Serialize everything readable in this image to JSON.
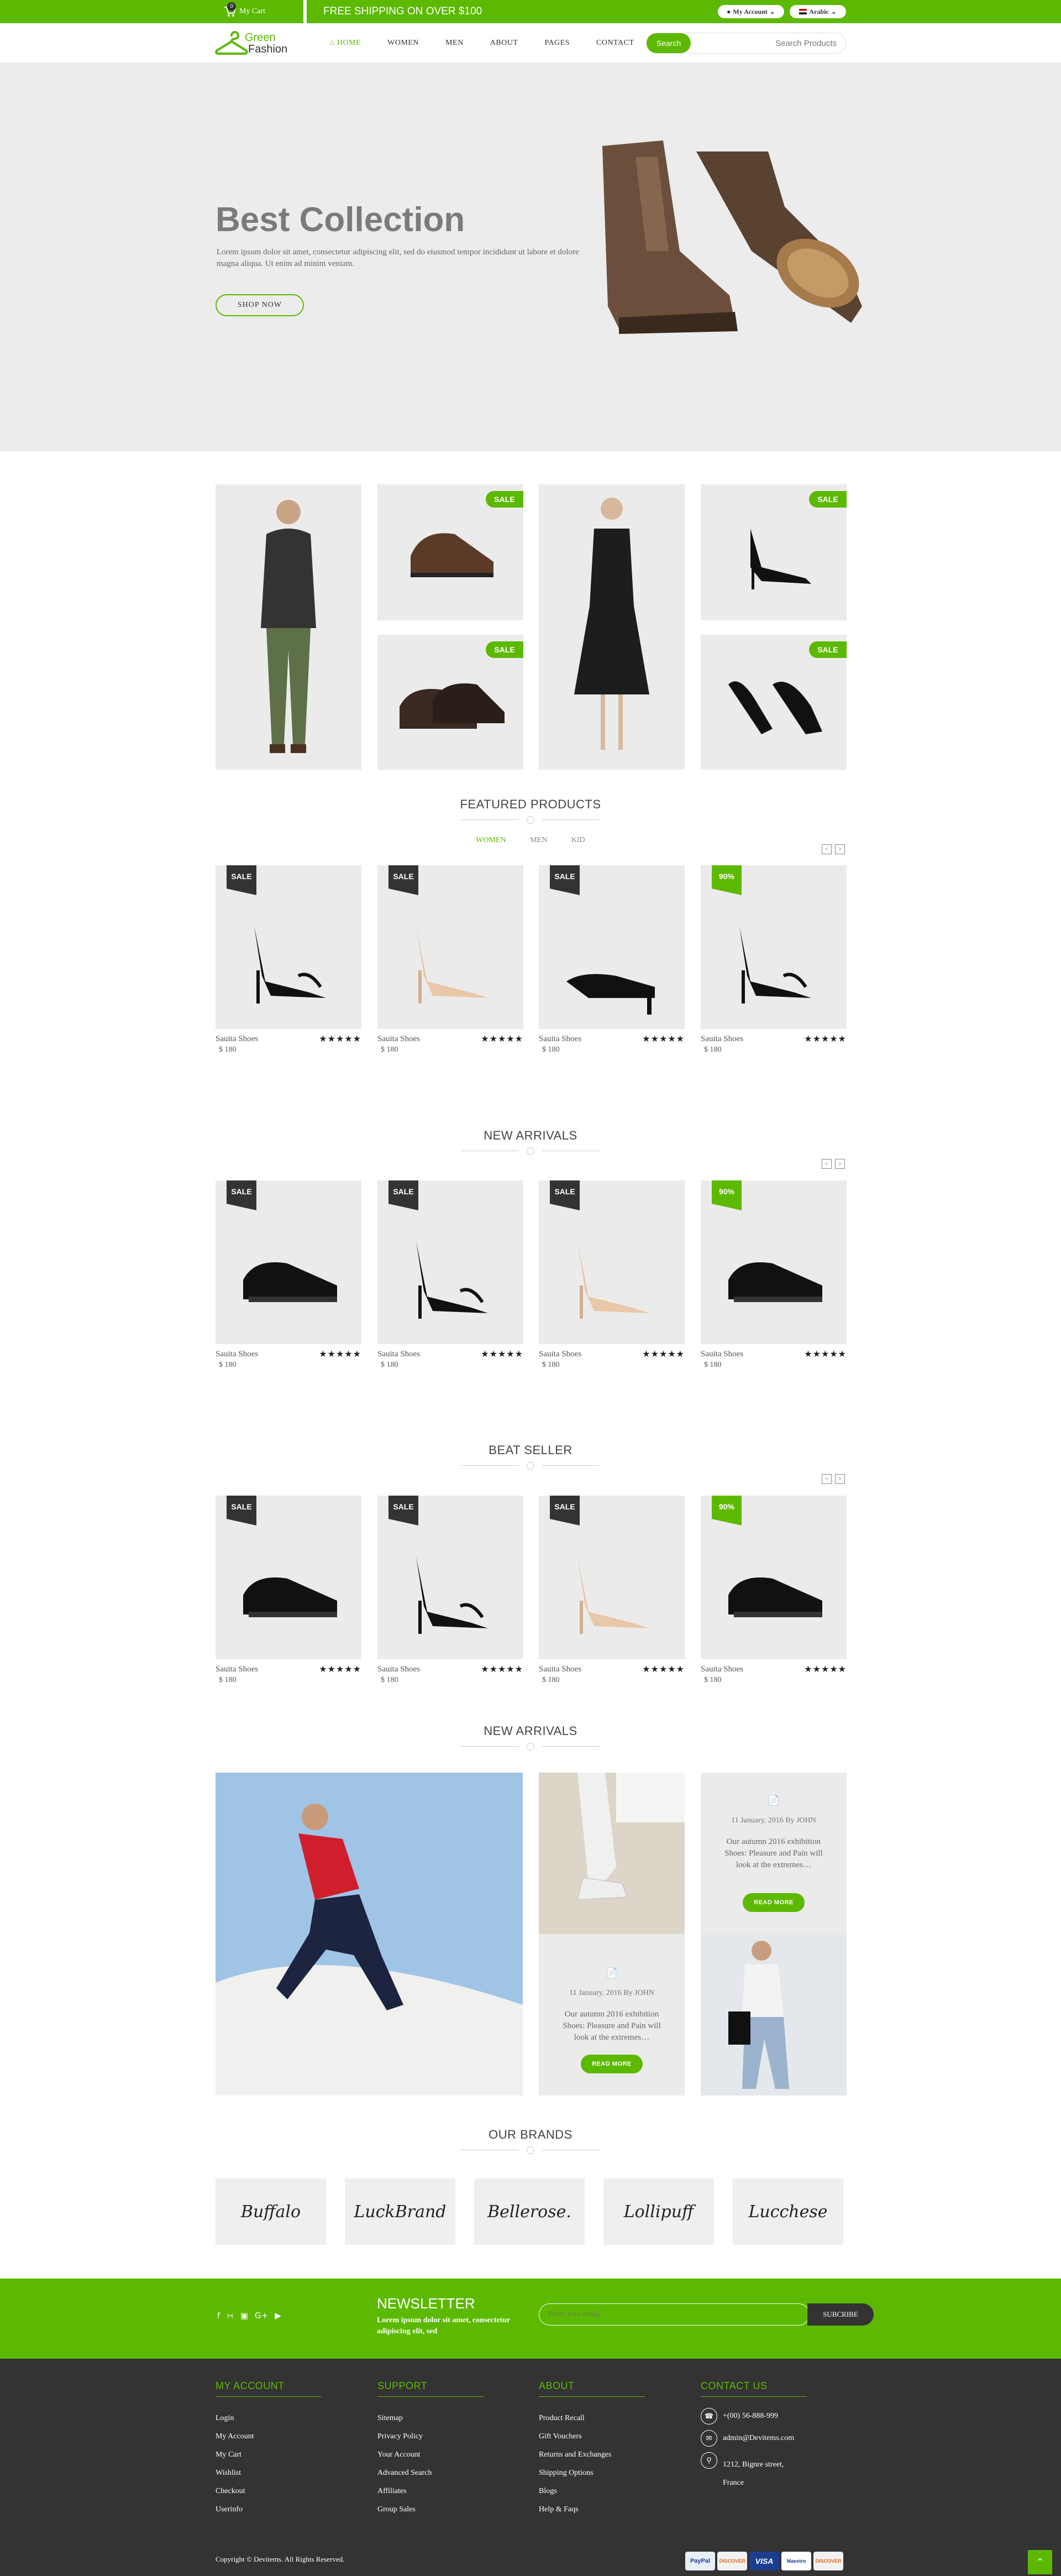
{
  "topbar": {
    "cart_label": "My Cart",
    "cart_count": "0",
    "shipping": "FREE SHIPPING ON OVER $100",
    "account": "My Account",
    "language": "Arabic"
  },
  "brand": {
    "line1": "Green",
    "line2": "Fashion"
  },
  "nav": {
    "home": "HOME",
    "women": "WOMEN",
    "men": "MEN",
    "about": "ABOUT",
    "pages": "PAGES",
    "contact": "CONTACT"
  },
  "search": {
    "button": "Search",
    "placeholder": "Search Products"
  },
  "hero": {
    "title": "Best Collection",
    "text": "Lorem ipsum dolor sit amet, consectetur adipiscing elit, sed do eiusmod tempor incididunt ut labore et dolore magna aliqua. Ut enim ad minim veniam.",
    "button": "SHOP NOW"
  },
  "promo": {
    "sale": "SALE"
  },
  "featured": {
    "title": "FEATURED PRODUCTS",
    "tabs": [
      "WOMEN",
      "MEN",
      "KID"
    ]
  },
  "new_arrivals": {
    "title": "NEW ARRIVALS"
  },
  "best_seller": {
    "title": "BEAT SELLER"
  },
  "product": {
    "name": "Sauita Shoes",
    "price": "$ 180",
    "stars": "★★★★★",
    "sale": "SALE",
    "discount": "90%"
  },
  "blog": {
    "title": "NEW ARRIVALS",
    "date": "11 January, 2016 By JOHN",
    "text": "Our autumn 2016 exhibition Shoes: Pleasure and Pain will look at the extremes…",
    "button": "READ MORE"
  },
  "brands": {
    "title": "OUR BRANDS",
    "items": [
      "Buffalo",
      "LuckBrand",
      "Bellerose.",
      "Lollipuff",
      "Lucchese"
    ]
  },
  "newsletter": {
    "title": "NEWSLETTER",
    "text": "Lorem ipsum dolor sit amet, consectetur adipiscing elit, sed",
    "placeholder": "Enter your email",
    "button": "SUBCRIBE"
  },
  "footer": {
    "my_account": {
      "title": "MY ACCOUNT",
      "items": [
        "Login",
        "My Account",
        "My Cart",
        "Wishlist",
        "Checkout",
        "Userinfo"
      ]
    },
    "support": {
      "title": "SUPPORT",
      "items": [
        "Sitemap",
        "Privacy Policy",
        "Your Account",
        "Advanced Search",
        "Affiliates",
        "Group Sales"
      ]
    },
    "about": {
      "title": "ABOUT",
      "items": [
        "Product Recall",
        "Gift Vouchers",
        "Returns and Exchanges",
        "Shipping Options",
        "Blogs",
        "Help & Faqs"
      ]
    },
    "contact": {
      "title": "CONTACT US",
      "phone": "+(00) 56-888-999",
      "email": "admin@Devitems.com",
      "address": "1212, Bignre street, France"
    },
    "copyright": "Copyright © Devitems. All Rights Reserved.",
    "payments": [
      "PayPal",
      "DISCOVER",
      "VISA",
      "Maestro",
      "DISCOVER"
    ]
  }
}
